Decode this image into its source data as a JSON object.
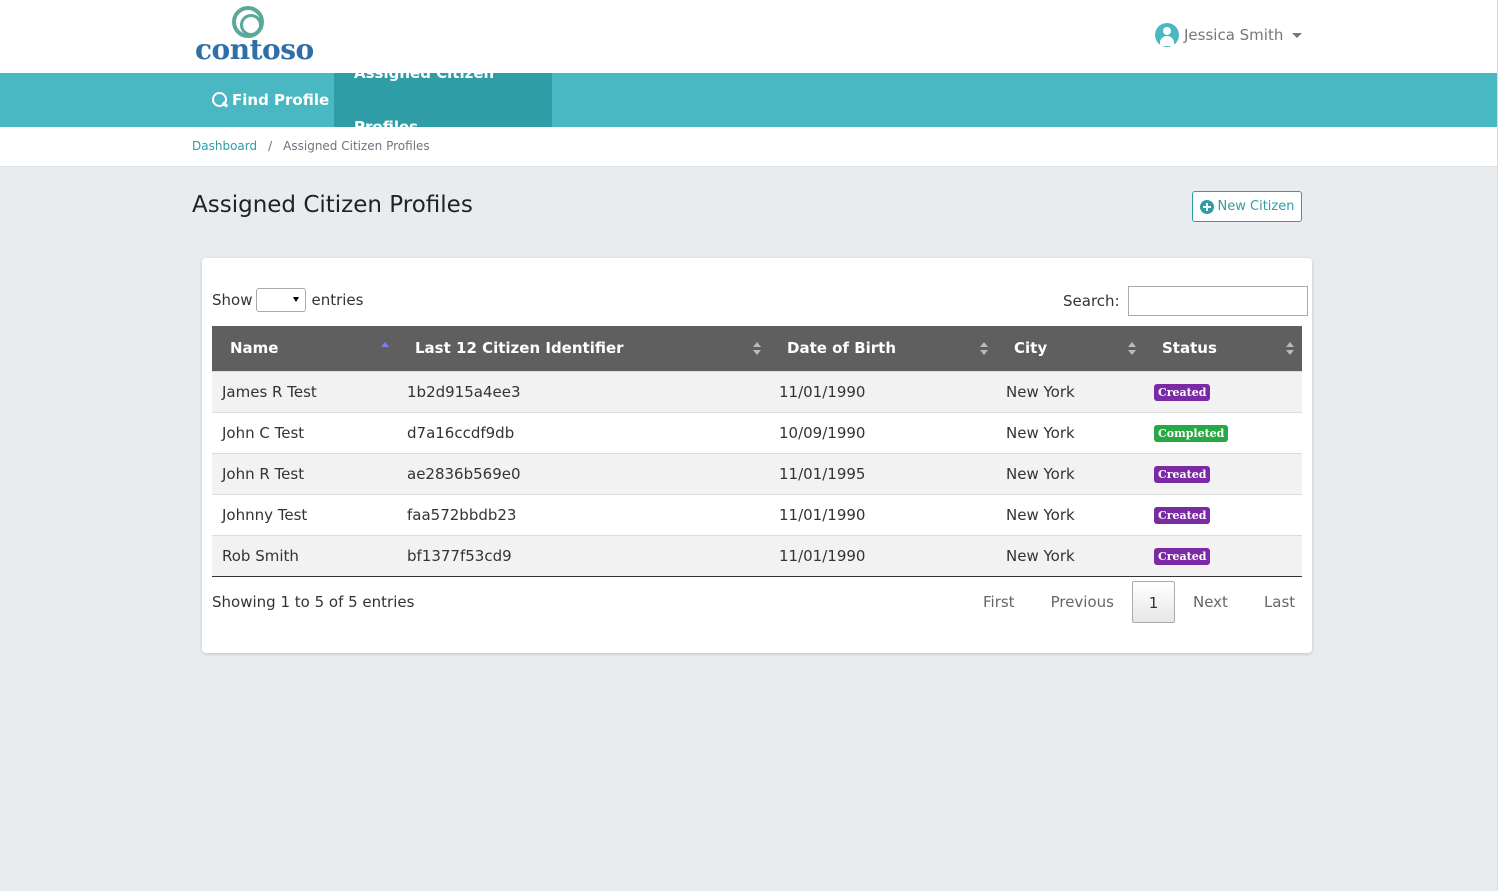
{
  "header": {
    "logo_text": "contoso",
    "user_name": "Jessica Smith"
  },
  "nav": {
    "items": [
      {
        "label": "Find Profile",
        "icon": "search-icon"
      },
      {
        "label": "Assigned Citizen Profiles",
        "active": true
      }
    ]
  },
  "breadcrumb": {
    "items": [
      "Dashboard",
      "Assigned Citizen Profiles"
    ],
    "separator": "/"
  },
  "page": {
    "title": "Assigned Citizen Profiles",
    "new_button_label": "New Citizen"
  },
  "table_controls": {
    "show_label": "Show",
    "entries_label": "entries",
    "search_label": "Search:",
    "search_value": ""
  },
  "table": {
    "columns": [
      "Name",
      "Last 12 Citizen Identifier",
      "Date of Birth",
      "City",
      "Status"
    ],
    "sorted_column": "Name",
    "rows": [
      {
        "name": "James R Test",
        "identifier": "1b2d915a4ee3",
        "dob": "11/01/1990",
        "city": "New York",
        "status": "Created"
      },
      {
        "name": "John C Test",
        "identifier": "d7a16ccdf9db",
        "dob": "10/09/1990",
        "city": "New York",
        "status": "Completed"
      },
      {
        "name": "John R Test",
        "identifier": "ae2836b569e0",
        "dob": "11/01/1995",
        "city": "New York",
        "status": "Created"
      },
      {
        "name": "Johnny Test",
        "identifier": "faa572bbdb23",
        "dob": "11/01/1990",
        "city": "New York",
        "status": "Created"
      },
      {
        "name": "Rob Smith",
        "identifier": "bf1377f53cd9",
        "dob": "11/01/1990",
        "city": "New York",
        "status": "Created"
      }
    ]
  },
  "status_colors": {
    "Created": "#7b2aa5",
    "Completed": "#28a745"
  },
  "footer": {
    "info": "Showing 1 to 5 of 5 entries",
    "pagination": {
      "first": "First",
      "previous": "Previous",
      "current": "1",
      "next": "Next",
      "last": "Last"
    }
  },
  "colors": {
    "nav_bg": "#4ab8c3",
    "nav_active": "#2f9da6",
    "accent": "#2f9da6",
    "table_header": "#5f5f5f",
    "page_bg": "#e9ecef"
  }
}
